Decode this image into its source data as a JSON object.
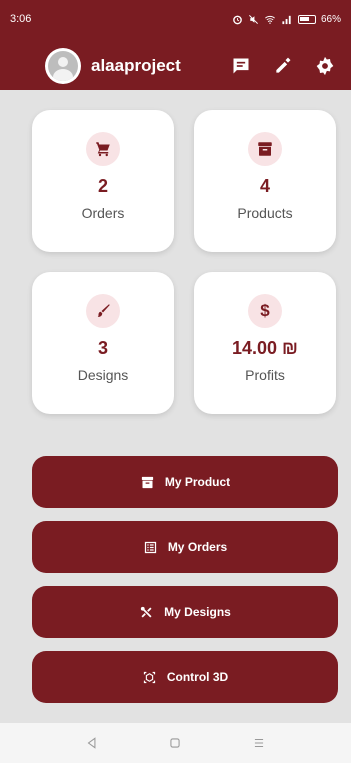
{
  "status_bar": {
    "time": "3:06",
    "battery": "66%",
    "icons": [
      "alarm-icon",
      "mute-icon",
      "wifi-icon",
      "signal-icon",
      "battery-icon"
    ]
  },
  "app_bar": {
    "username": "alaaproject",
    "actions": [
      "chat-icon",
      "edit-icon",
      "settings-icon"
    ]
  },
  "stats": [
    {
      "icon": "cart-icon",
      "value": "2",
      "label": "Orders"
    },
    {
      "icon": "archive-icon",
      "value": "4",
      "label": "Products"
    },
    {
      "icon": "brush-icon",
      "value": "3",
      "label": "Designs"
    },
    {
      "icon": "dollar-icon",
      "icon_text": "$",
      "value": "14.00 ₪",
      "label": "Profits"
    }
  ],
  "buttons": [
    {
      "icon": "archive-icon",
      "label": "My Product"
    },
    {
      "icon": "list-icon",
      "label": "My Orders"
    },
    {
      "icon": "tools-icon",
      "label": "My Designs"
    },
    {
      "icon": "3d-rotate-icon",
      "label": "Control 3D"
    }
  ],
  "nav_bar": [
    "back-icon",
    "home-icon",
    "recents-icon"
  ],
  "colors": {
    "brand": "#7a1c22",
    "badge_bg": "#f8e3e5",
    "background": "#e2e2e2"
  }
}
